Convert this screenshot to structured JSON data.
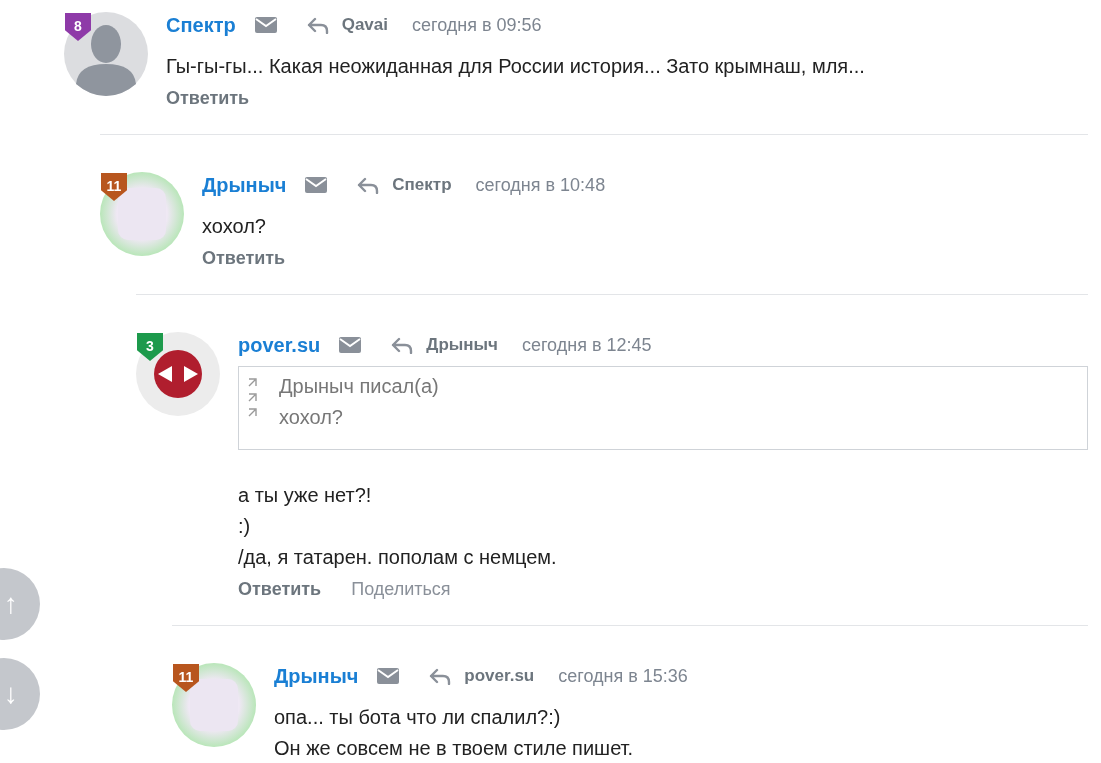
{
  "comments": [
    {
      "author": "Спектр",
      "reply_to": "Qavai",
      "time": "сегодня в 09:56",
      "avatar": {
        "kind": "silhouette"
      },
      "badge": {
        "text": "8",
        "color": "#8e3aa8"
      },
      "body": [
        "Гы-гы-гы... Какая неожиданная для России история... Зато крымнаш, мля..."
      ],
      "actions": [
        {
          "label": "Ответить",
          "kind": "primary"
        }
      ],
      "children": [
        {
          "author": "Дрыныч",
          "reply_to": "Спектр",
          "time": "сегодня в 10:48",
          "avatar": {
            "kind": "blurred"
          },
          "badge": {
            "text": "11",
            "color": "#b8561e"
          },
          "body": [
            "хохол?"
          ],
          "actions": [
            {
              "label": "Ответить",
              "kind": "primary"
            }
          ],
          "children": [
            {
              "author": "pover.su",
              "reply_to": "Дрыныч",
              "time": "сегодня в 12:45",
              "avatar": {
                "kind": "logo"
              },
              "badge": {
                "text": "3",
                "color": "#1d9a4c"
              },
              "quote": {
                "author_line": "Дрыныч писал(а)",
                "text": "хохол?"
              },
              "body": [
                "а ты уже нет?!",
                ":)",
                "/да, я татарен. пополам с немцем."
              ],
              "actions": [
                {
                  "label": "Ответить",
                  "kind": "primary"
                },
                {
                  "label": "Поделиться",
                  "kind": "secondary"
                }
              ],
              "children": [
                {
                  "author": "Дрыныч",
                  "reply_to": "pover.su",
                  "time": "сегодня в 15:36",
                  "avatar": {
                    "kind": "blurred"
                  },
                  "badge": {
                    "text": "11",
                    "color": "#b8561e"
                  },
                  "body": [
                    "опа... ты бота что ли спалил?:)",
                    "Он же совсем не в твоем стиле пишет."
                  ]
                }
              ]
            }
          ]
        }
      ]
    }
  ],
  "scroll_buttons": [
    {
      "glyph": "↑"
    },
    {
      "glyph": "↓"
    }
  ]
}
